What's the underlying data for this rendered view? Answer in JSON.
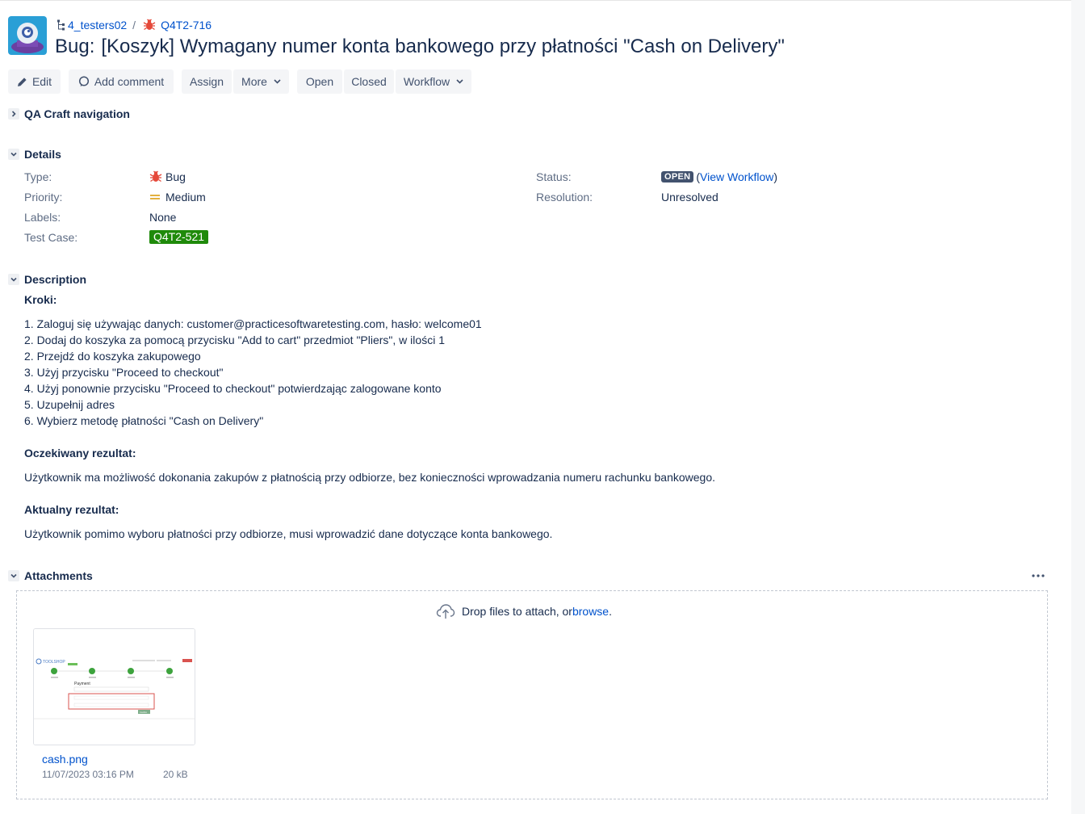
{
  "breadcrumb": {
    "project": "4_testers02",
    "issue_key": "Q4T2-716"
  },
  "issue": {
    "type_prefix": "Bug:",
    "summary": "[Koszyk] Wymagany numer konta bankowego przy płatności \"Cash on Delivery\""
  },
  "toolbar": {
    "edit": "Edit",
    "add_comment": "Add comment",
    "assign": "Assign",
    "more": "More",
    "open": "Open",
    "closed": "Closed",
    "workflow": "Workflow"
  },
  "sections": {
    "qa_nav": "QA Craft navigation",
    "details": "Details",
    "description": "Description",
    "attachments": "Attachments"
  },
  "details": {
    "type_label": "Type:",
    "type_value": "Bug",
    "priority_label": "Priority:",
    "priority_value": "Medium",
    "labels_label": "Labels:",
    "labels_value": "None",
    "testcase_label": "Test Case:",
    "testcase_value": "Q4T2-521",
    "status_label": "Status:",
    "status_value": "OPEN",
    "view_workflow": "View Workflow",
    "paren_open": "(",
    "paren_close": ")",
    "resolution_label": "Resolution:",
    "resolution_value": "Unresolved"
  },
  "description": {
    "steps_heading": "Kroki:",
    "steps": [
      "1. Zaloguj się używając danych: customer@practicesoftwaretesting.com, hasło: welcome01",
      "2. Dodaj do koszyka za pomocą przycisku \"Add to cart\" przedmiot \"Pliers\", w ilości 1",
      "2. Przejdź do koszyka zakupowego",
      "3. Użyj przycisku \"Proceed to checkout\"",
      "4. Użyj ponownie przycisku \"Proceed to checkout\" potwierdzając zalogowane konto",
      "5. Uzupełnij adres",
      "6. Wybierz metodę płatności \"Cash on Delivery\""
    ],
    "expected_heading": "Oczekiwany rezultat:",
    "expected_text": "Użytkownik ma możliwość dokonania zakupów z płatnością przy odbiorze, bez konieczności wprowadzania numeru rachunku bankowego.",
    "actual_heading": "Aktualny rezultat:",
    "actual_text": "Użytkownik pomimo wyboru płatności przy odbiorze, musi wprowadzić dane dotyczące konta bankowego."
  },
  "attachments": {
    "drop_text": "Drop files to attach, or ",
    "browse": "browse",
    "period": ".",
    "file": {
      "name": "cash.png",
      "date": "11/07/2023 03:16 PM",
      "size": "20 kB"
    },
    "thumbnail_text": {
      "brand": "TOOLSHOP",
      "heading": "Payment",
      "button": "Confirm"
    }
  },
  "colors": {
    "link": "#0052cc",
    "text": "#172b4d",
    "muted": "#5e6c84",
    "status_lozenge": "#42526e",
    "test_case_badge": "#1f8a0a",
    "bug_red": "#e5493a",
    "priority_yellow": "#e3b13f",
    "button_bg": "#f4f5f7"
  },
  "icons": {
    "project": "project-avatar-icon",
    "tree": "hierarchy-icon",
    "bug": "bug-icon",
    "edit": "pencil-icon",
    "comment": "comment-icon",
    "chevron": "chevron-down-icon",
    "priority": "priority-medium-icon",
    "upload": "cloud-upload-icon",
    "more": "more-horizontal-icon"
  }
}
